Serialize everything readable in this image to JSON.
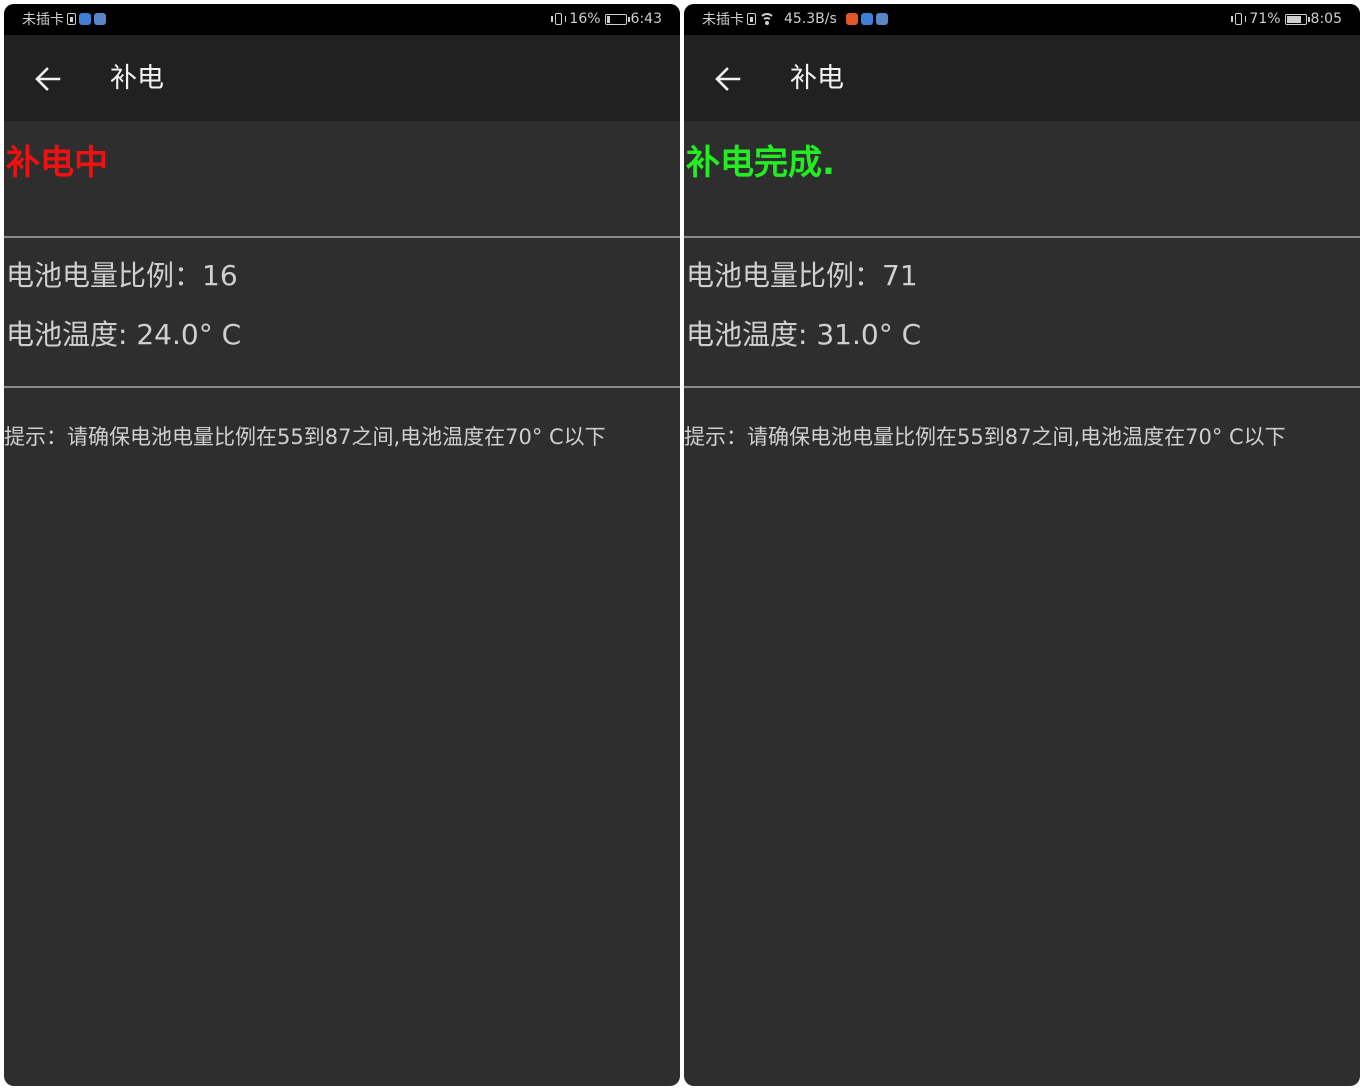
{
  "screens": [
    {
      "status_bar": {
        "carrier": "未插卡",
        "network_speed": "",
        "battery_percent": "16%",
        "battery_level": 0.16,
        "time": "6:43",
        "icons": [
          "sim-icon",
          "browser-app-icon",
          "video-app-icon",
          "vibrate-icon",
          "battery-icon"
        ]
      },
      "toolbar": {
        "back_icon": "arrow-left-icon",
        "title": "补电"
      },
      "status_text": "补电中",
      "status_color": "#ee1111",
      "battery_ratio_label": "电池电量比例：",
      "battery_ratio_value": "16",
      "battery_temp_label": "电池温度: ",
      "battery_temp_value": "24.0° C",
      "hint": "提示：请确保电池电量比例在55到87之间,电池温度在70° C以下"
    },
    {
      "status_bar": {
        "carrier": "未插卡",
        "network_speed": "45.3B/s",
        "battery_percent": "71%",
        "battery_level": 0.71,
        "time": "8:05",
        "icons": [
          "sim-icon",
          "wifi-icon",
          "orange-app-icon",
          "browser-app-icon",
          "video-app-icon",
          "vibrate-icon",
          "battery-icon"
        ]
      },
      "toolbar": {
        "back_icon": "arrow-left-icon",
        "title": "补电"
      },
      "status_text": "补电完成.",
      "status_color": "#22ee22",
      "battery_ratio_label": "电池电量比例：",
      "battery_ratio_value": "71",
      "battery_temp_label": "电池温度: ",
      "battery_temp_value": "31.0° C",
      "hint": "提示：请确保电池电量比例在55到87之间,电池温度在70° C以下"
    }
  ]
}
